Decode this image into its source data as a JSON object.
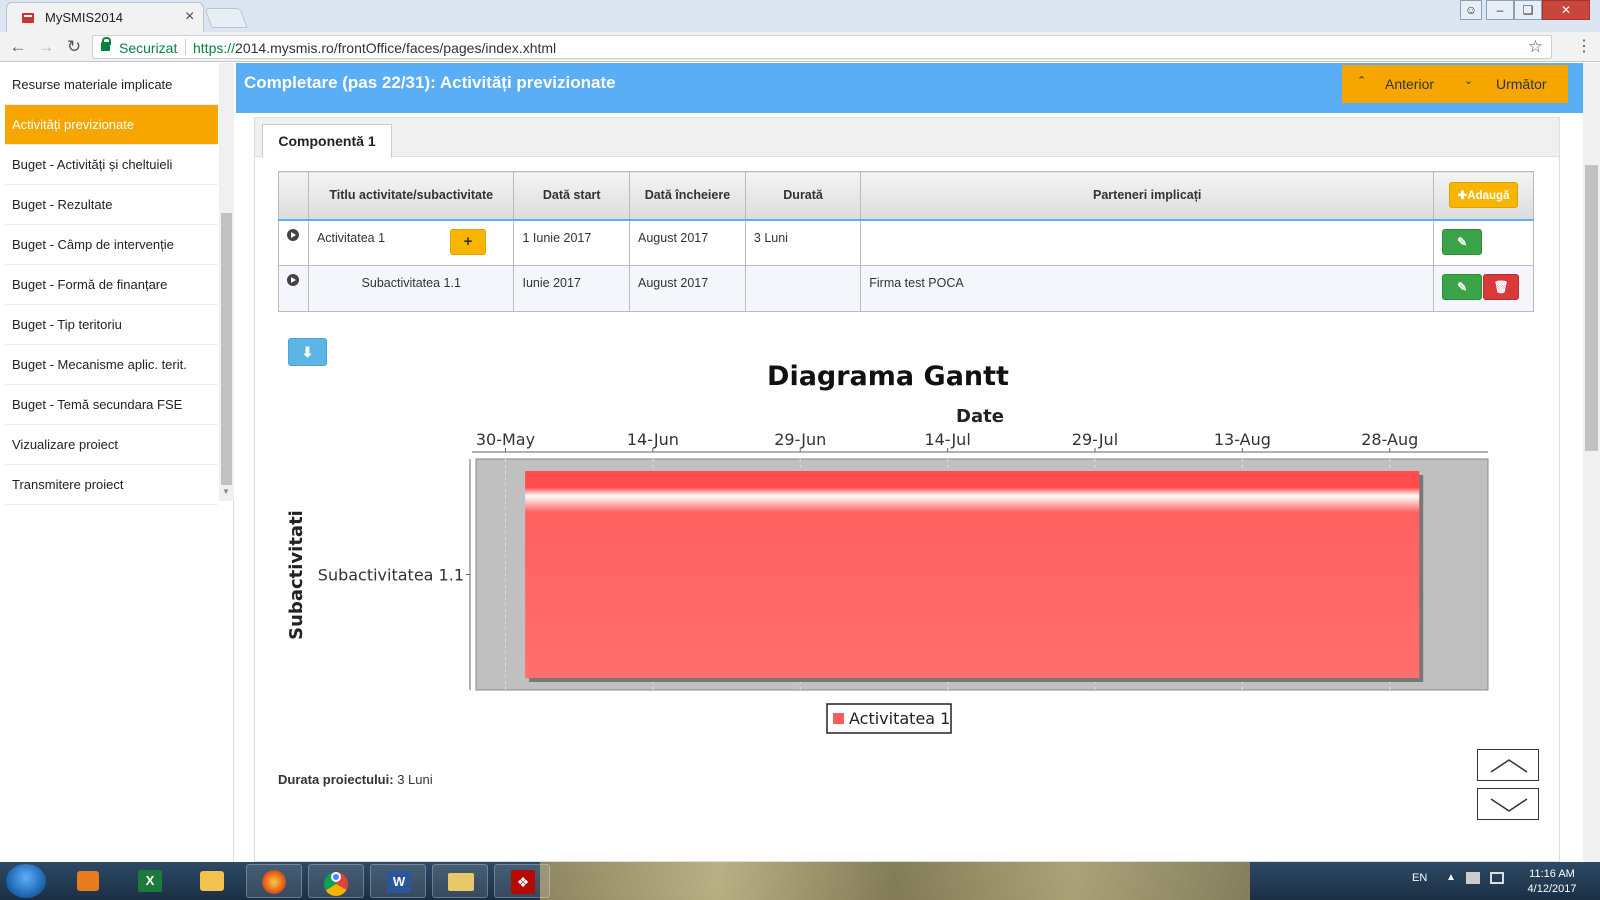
{
  "browser": {
    "tab_title": "MySMIS2014",
    "tab_close": "×",
    "secure_label": "Securizat",
    "url_scheme": "https://",
    "url_rest": "2014.mysmis.ro/frontOffice/faces/pages/index.xhtml"
  },
  "sidebar": {
    "items": [
      {
        "label": "Resurse materiale implicate",
        "active": false
      },
      {
        "label": "Activități previzionate",
        "active": true
      },
      {
        "label": "Buget - Activități și cheltuieli",
        "active": false
      },
      {
        "label": "Buget - Rezultate",
        "active": false
      },
      {
        "label": "Buget - Câmp de intervenție",
        "active": false
      },
      {
        "label": "Buget - Formă de finanțare",
        "active": false
      },
      {
        "label": "Buget - Tip teritoriu",
        "active": false
      },
      {
        "label": "Buget - Mecanisme aplic. terit.",
        "active": false
      },
      {
        "label": "Buget - Temă secundara FSE",
        "active": false
      },
      {
        "label": "Vizualizare proiect",
        "active": false
      },
      {
        "label": "Transmitere proiect",
        "active": false
      }
    ]
  },
  "header": {
    "title": "Completare (pas 22/31): Activități previzionate",
    "prev_label": "Anterior",
    "next_label": "Următor"
  },
  "tabs": {
    "component": "Componentă 1"
  },
  "table": {
    "columns": [
      "Titlu activitate/subactivitate",
      "Dată start",
      "Dată încheiere",
      "Durată",
      "Parteneri implicați"
    ],
    "add_label": "Adaugă",
    "rows": [
      {
        "title": "Activitatea 1",
        "start": "1 Iunie 2017",
        "end": "August 2017",
        "duration": "3 Luni",
        "partners": ""
      },
      {
        "title": "Subactivitatea 1.1",
        "start": "Iunie 2017",
        "end": "August 2017",
        "duration": "",
        "partners": "Firma test POCA"
      }
    ]
  },
  "chart_data": {
    "type": "gantt",
    "title": "Diagrama Gantt",
    "xlabel": "Date",
    "ylabel": "Subactivitati",
    "x_ticks": [
      "30-May",
      "14-Jun",
      "29-Jun",
      "14-Jul",
      "29-Jul",
      "13-Aug",
      "28-Aug"
    ],
    "xlim": [
      "2017-05-27",
      "2017-09-07"
    ],
    "tasks": [
      {
        "label": "Subactivitatea 1.1",
        "start": "2017-06-01",
        "end": "2017-08-31",
        "series": "Activitatea 1"
      }
    ],
    "legend": [
      "Activitatea 1"
    ],
    "legend_position": "bottom",
    "bar_color": "#ff5b5b",
    "plot_bg": "#c0c0c0"
  },
  "footer": {
    "duration_label": "Durata proiectului:",
    "duration_value": "3 Luni"
  },
  "taskbar": {
    "lang": "EN",
    "time": "11:16 AM",
    "date": "4/12/2017"
  }
}
